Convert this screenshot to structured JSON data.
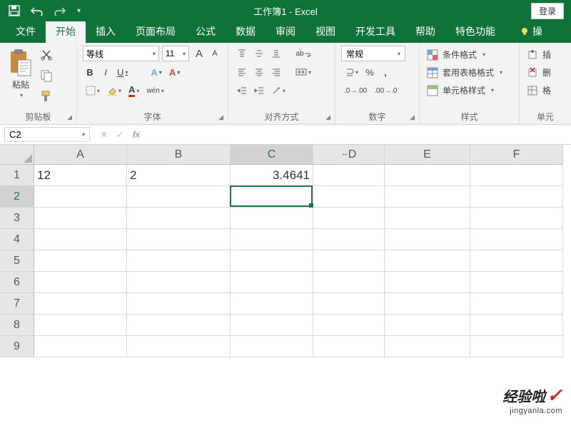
{
  "title": "工作簿1 - Excel",
  "login_label": "登录",
  "tabs": {
    "file": "文件",
    "home": "开始",
    "insert": "插入",
    "layout": "页面布局",
    "formulas": "公式",
    "data": "数据",
    "review": "审阅",
    "view": "视图",
    "developer": "开发工具",
    "help": "帮助",
    "special": "特色功能",
    "tell": "操"
  },
  "ribbon": {
    "clipboard": {
      "paste": "粘贴",
      "label": "剪贴板"
    },
    "font": {
      "name": "等线",
      "size": "11",
      "label": "字体",
      "bold": "B",
      "italic": "I",
      "underline": "U",
      "grow": "A",
      "shrink": "A",
      "fontcolor": "A",
      "phonetic": "wén"
    },
    "alignment": {
      "label": "对齐方式",
      "wrap": "ab"
    },
    "number": {
      "label": "数字",
      "format": "常规",
      "percent": "%",
      "comma": ","
    },
    "styles": {
      "label": "样式",
      "conditional": "条件格式",
      "table": "套用表格格式",
      "cell": "单元格样式"
    },
    "cells": {
      "label": "单元",
      "insert": "插",
      "delete": "删",
      "format": "格"
    }
  },
  "formula_bar": {
    "name_box": "C2",
    "fx": "fx",
    "value": ""
  },
  "columns": [
    "A",
    "B",
    "C",
    "D",
    "E",
    "F"
  ],
  "rows": [
    "1",
    "2",
    "3",
    "4",
    "5",
    "6",
    "7",
    "8",
    "9"
  ],
  "resize_indicator_col": "D",
  "cells": {
    "A1": "12",
    "B1": "2",
    "C1": "3.4641"
  },
  "selection": {
    "cell": "C2",
    "col": "C",
    "row": "2"
  },
  "watermark": {
    "brand": "经验啦",
    "check": "✓",
    "url": "jingyanla.com"
  }
}
